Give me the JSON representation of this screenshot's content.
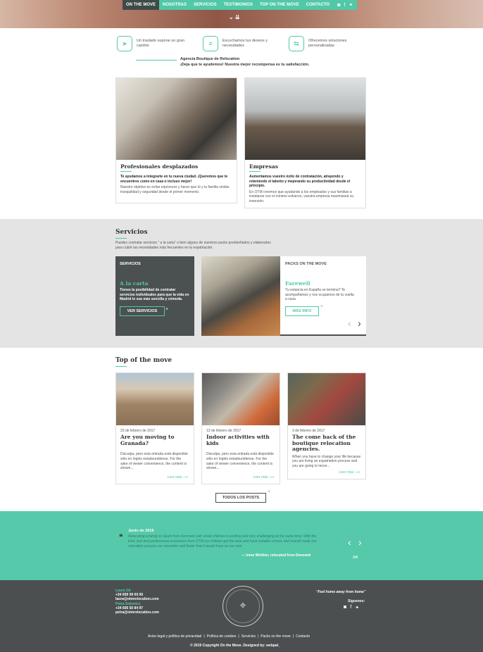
{
  "nav": {
    "items": [
      "On the move",
      "Nosotras",
      "Servicios",
      "Testimonios",
      "Top on the move",
      "Contacto"
    ]
  },
  "features": [
    {
      "icon": "paper-plane-icon",
      "text": "Un traslado supone un gran cambio"
    },
    {
      "icon": "chat-icon",
      "text": "Escuchamos tus deseos y necesidades"
    },
    {
      "icon": "signpost-icon",
      "text": "Ofrecemos soluciones personalizadas"
    }
  ],
  "tagline": {
    "line1": "Agencia Boutique de Relocation",
    "line2": "¡Deja que te ayudemos! Nuestra mejor recompensa es tu satisfacción."
  },
  "cards": [
    {
      "title": "Profesionales desplazados",
      "bold": "Te ayudamos a integrarte en tu nueva ciudad. ¡Queremos que te encuentres como en casa o incluso mejor!",
      "text": "Nuestro objetivo es evitar equívocos y hacer que tú y tu familia sintáis tranquilidad y seguridad desde el primer momento."
    },
    {
      "title": "Empresas",
      "bold": "Aumentamos vuestro éxito de contratación, atrayendo y reteniendo el talento y mejorando su productividad desde el principio.",
      "text": "En OTM creemos que ayudando a los empleados y sus familias a instalarse con el mínimo esfuerzo, vuestra empresa maximizará su inversión."
    }
  ],
  "servicios": {
    "title": "Servicios",
    "intro": "Puedes contratar servicios \" a la carta\" o bien alguno de nuestros packs prediseñados y elaborados para cubrir las necesidades más frecuentes en la expatriación.",
    "dark": {
      "label": "SERVICIOS",
      "title": "A la carta",
      "text": "Tienes la posibilidad de contratar servicios individuales para que la vida en Madrid te sea más sencilla y cómoda.",
      "button": "VER SERVICIOS"
    },
    "pack": {
      "label": "PACKS ON THE MOVE",
      "title": "Farewell",
      "text": "Tu estancia en España se termina? Te acompañamos y nos ocupamos de tu vuelta a casa.",
      "button": "MÁS INFO"
    }
  },
  "top": {
    "title": "Top of the move",
    "posts": [
      {
        "date": "23 de febrero de 2017",
        "title": "Are you moving to Granada?",
        "text": "Disculpa, pero esta entrada está disponible sólo en Inglés estadounidense. For the sake of viewer convenience, the content is shown...",
        "more": "Leer más"
      },
      {
        "date": "13 de febrero de 2017",
        "title": "Indoor activities with kids",
        "text": "Disculpa, pero esta entrada está disponible sólo en Inglés estadounidense. For the sake of viewer convenience, the content is shown...",
        "more": "Leer más"
      },
      {
        "date": "3 de febrero de 2017",
        "title": "The come back of the boutique relocation agencies.",
        "text": "When you have to change your life because you are living an expatriation process and you are going to move...",
        "more": "Leer más"
      }
    ],
    "button": "TODOS LOS POSTS"
  },
  "testimonial": {
    "date": "Junio de 2016",
    "text": "Relocating a family to Spain from Denmark with small children is exciting and very challenging at the same time. With the kind, fast and professional assistance from OTM my children got the best and most suitable school, and overall made our relocation process run smoother and faster that it would have on our own.",
    "author": "— Irene Winther, relocated from Denmark",
    "pager": "1/4"
  },
  "footer": {
    "contact": [
      {
        "name": "Laura Gil",
        "phone": "+34 659 09 00 09",
        "email": "laura@otmrelocation.com"
      },
      {
        "name": "Petra Sokovicz",
        "phone": "+34 606 50 84 97",
        "email": "petra@otmrelocation.com"
      }
    ],
    "logo_text": "ON THE MOVE · RELOCATION SOLUTIONS",
    "slogan": "\"Feel home away from home\"",
    "follow": "Síguenos:",
    "links": [
      "Aviso legal y política de privacidad",
      "Política de cookies",
      "Servicios",
      "Packs on the move",
      "Contacto"
    ],
    "copyright": "© 2019 Copyright On the Move. Designed by: webpal_"
  },
  "colors": {
    "accent": "#51c8a8",
    "dark": "#4b4f4f"
  }
}
